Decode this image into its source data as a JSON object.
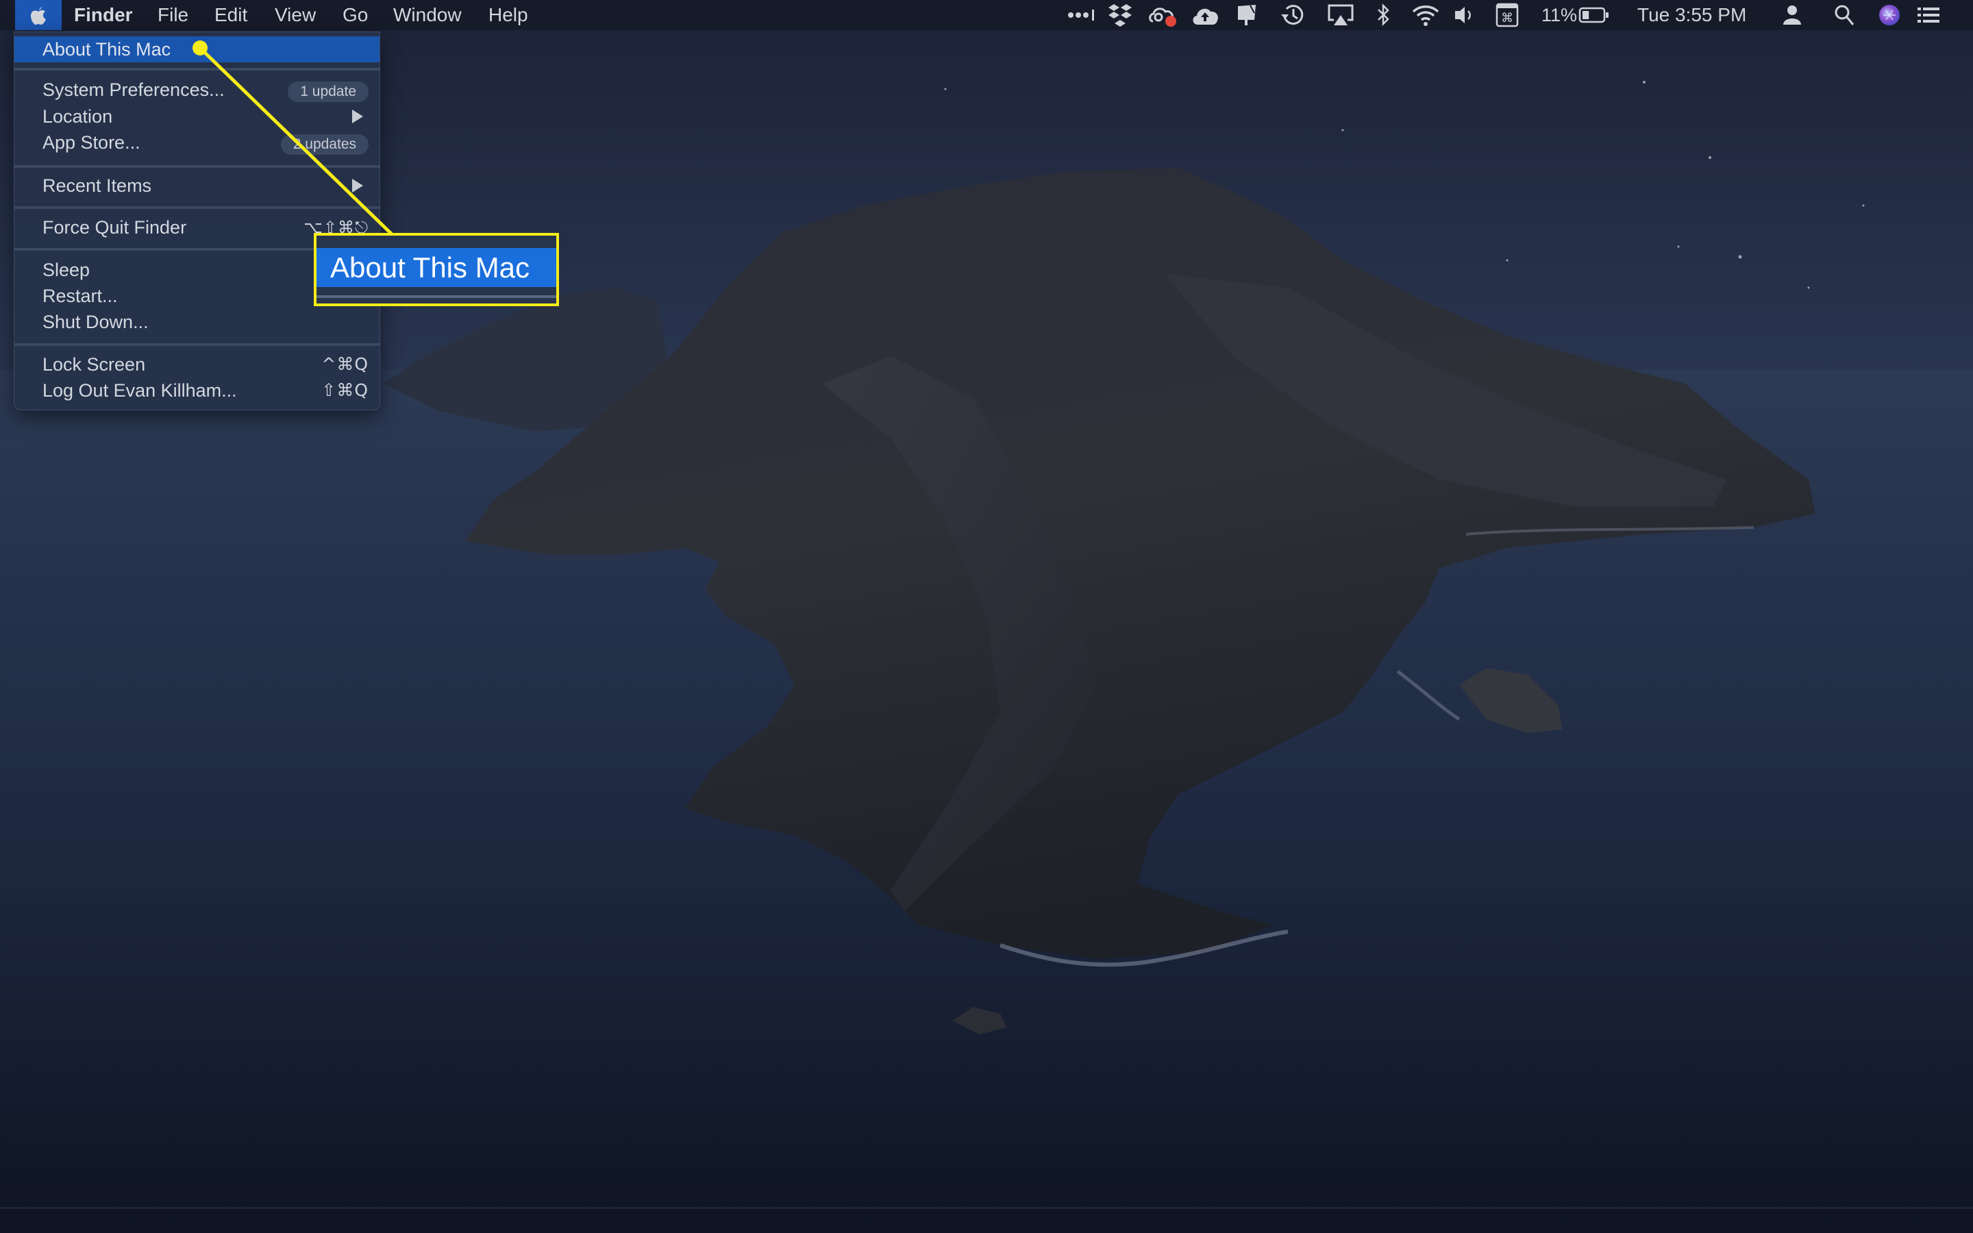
{
  "menubar": {
    "app_name": "Finder",
    "menus": [
      "File",
      "Edit",
      "View",
      "Go",
      "Window",
      "Help"
    ],
    "status_icons": [
      "overflow-dots-icon",
      "dropbox-icon",
      "creative-cloud-icon",
      "cloud-upload-icon",
      "notification-icon",
      "time-machine-icon",
      "airplay-icon",
      "bluetooth-icon",
      "wifi-icon",
      "volume-icon",
      "command-icon",
      "battery-icon",
      "user-icon",
      "spotlight-search-icon",
      "siri-icon",
      "notification-center-icon"
    ],
    "battery_percent": "11%",
    "battery_level": 0.11,
    "clock": "Tue 3:55 PM",
    "creative_cloud_badge_color": "#e0463b"
  },
  "apple_menu": {
    "items": [
      {
        "label": "About This Mac",
        "highlighted": true
      },
      {
        "label": "System Preferences...",
        "badge": "1 update"
      },
      {
        "label": "Location",
        "submenu": true
      },
      {
        "label": "App Store...",
        "badge": "2 updates"
      },
      {
        "label": "Recent Items",
        "submenu": true
      },
      {
        "label": "Force Quit Finder",
        "shortcut": "⌥⇧⌘⎋"
      },
      {
        "label": "Sleep"
      },
      {
        "label": "Restart..."
      },
      {
        "label": "Shut Down..."
      },
      {
        "label": "Lock Screen",
        "shortcut": "^⌘Q"
      },
      {
        "label": "Log Out Evan Killham...",
        "shortcut": "⇧⌘Q"
      }
    ]
  },
  "callout": {
    "label": "About This Mac",
    "border_color": "#f6ec18",
    "highlight_color": "#1b6fdc"
  },
  "colors": {
    "menubar_bg": "#161b2a",
    "menu_highlight": "#1a55ad",
    "annotation_yellow": "#f6ec18"
  }
}
